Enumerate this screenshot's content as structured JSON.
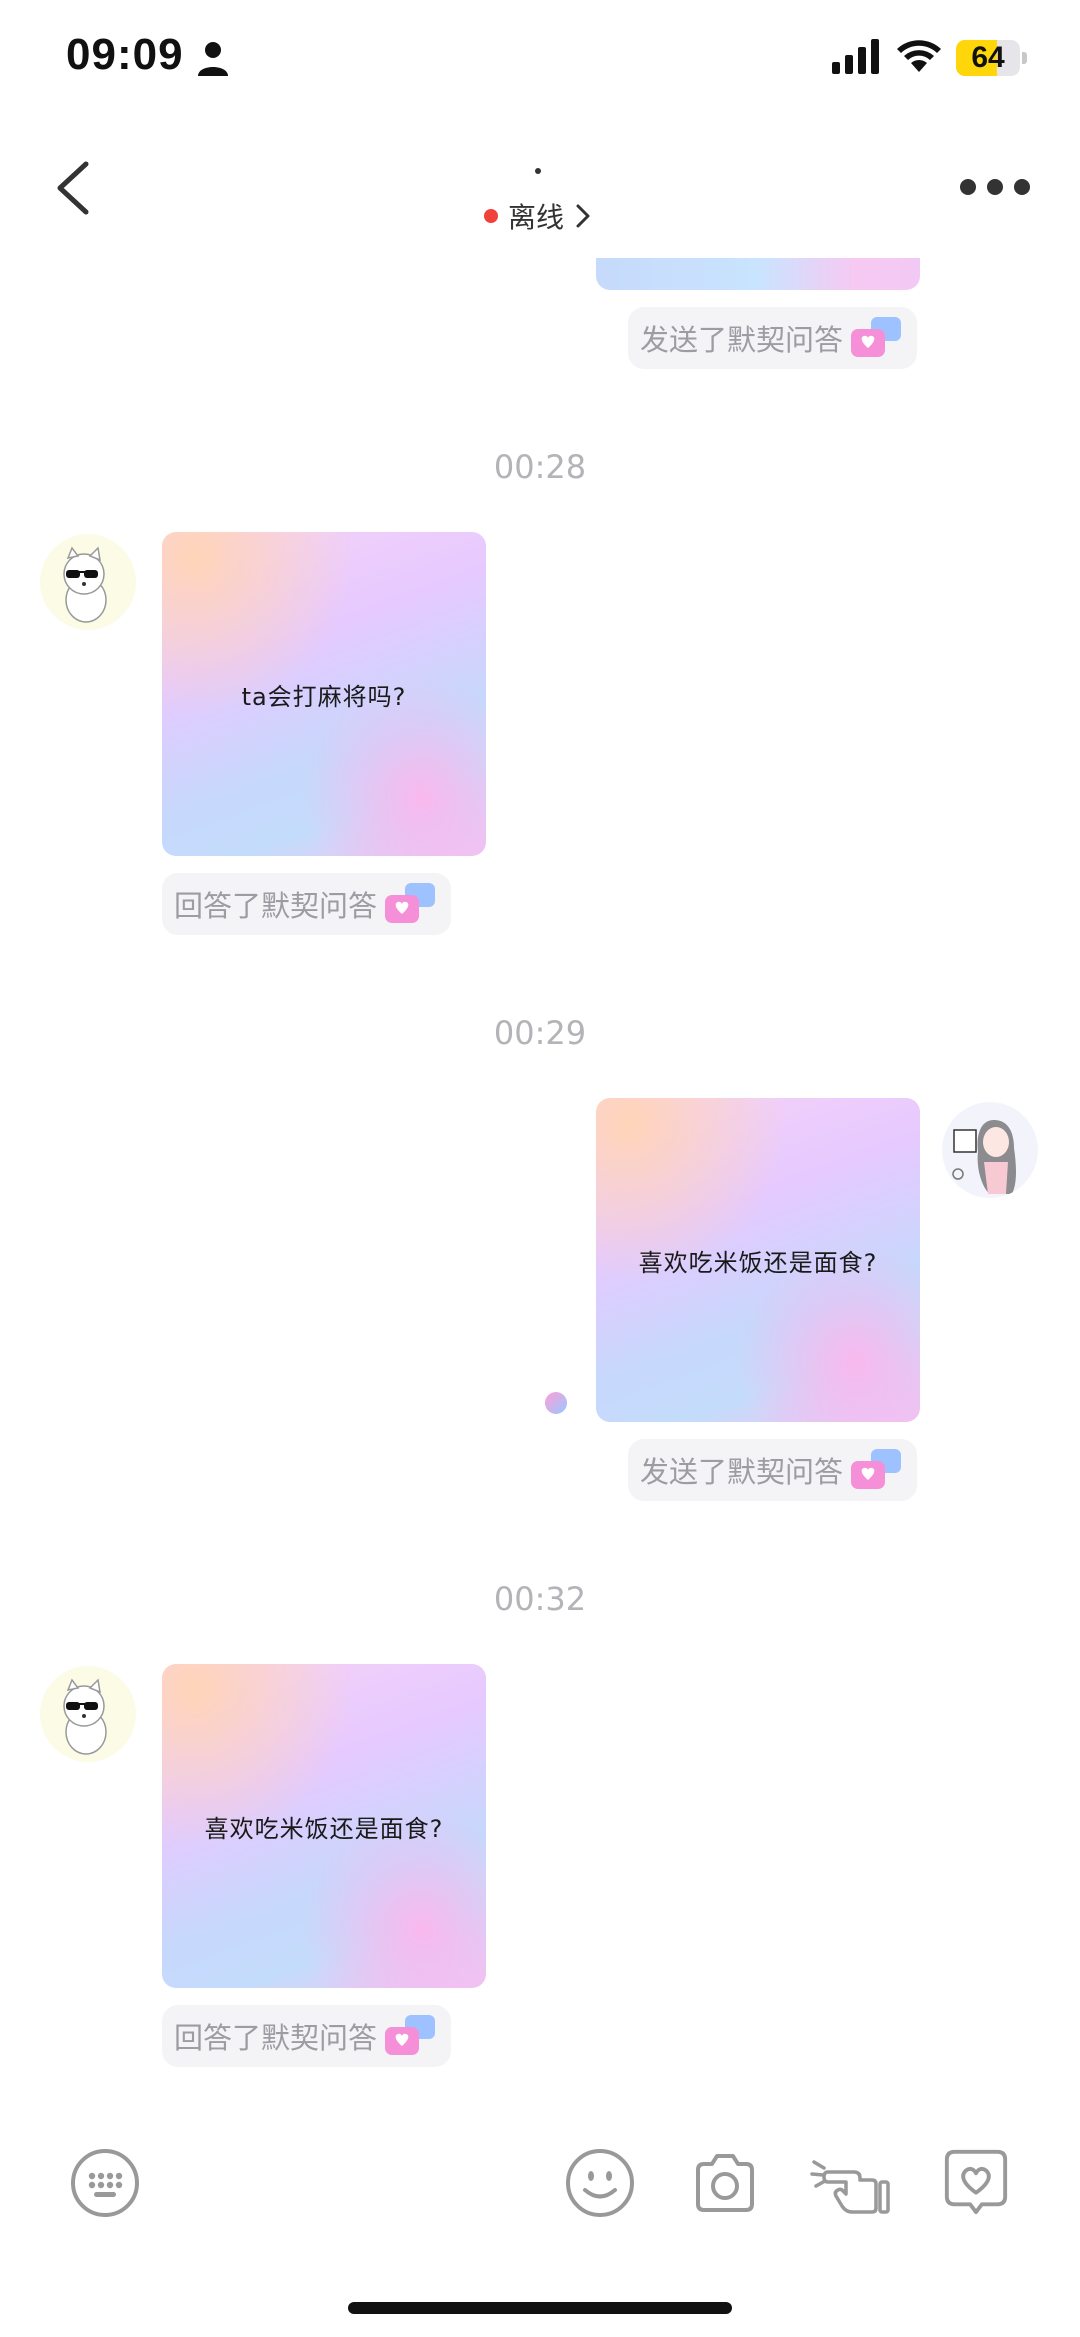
{
  "status_bar": {
    "time": "09:09",
    "battery": "64",
    "battery_level": 0.64
  },
  "header": {
    "status": "离线",
    "status_color": "#f0413b"
  },
  "messages": {
    "partial_pill": "发送了默契问答",
    "ts1": "00:28",
    "q1": "ta会打麻将吗?",
    "pill1": "回答了默契问答",
    "ts2": "00:29",
    "q2": "喜欢吃米饭还是面食?",
    "pill2": "发送了默契问答",
    "ts3": "00:32",
    "q3": "喜欢吃米饭还是面食?",
    "pill3": "回答了默契问答"
  },
  "toolbar": {
    "icons": [
      "keyboard-icon",
      "emoji-icon",
      "camera-icon",
      "poke-icon",
      "heart-message-icon"
    ]
  },
  "colors": {
    "accent_pink": "#f28bd9",
    "accent_blue": "#8fb8ff",
    "muted_text": "#9c9ca2"
  }
}
